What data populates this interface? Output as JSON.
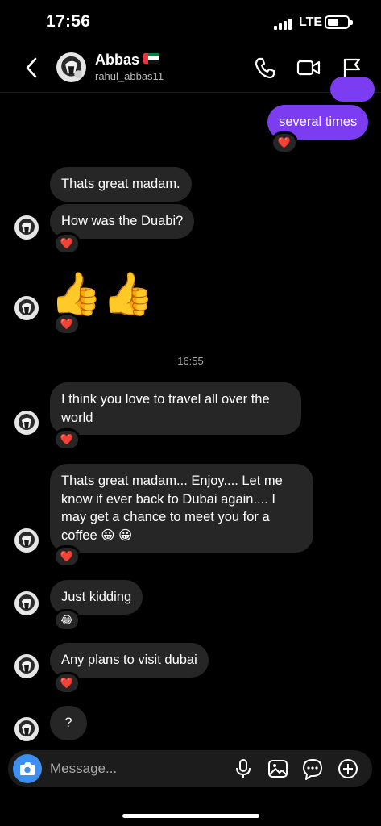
{
  "status_bar": {
    "time": "17:56",
    "network": "LTE"
  },
  "header": {
    "name": "Abbas",
    "username": "rahul_abbas11"
  },
  "messages": {
    "m0": {
      "text": "several times",
      "reaction": "❤️"
    },
    "m1": {
      "text": "Thats great madam."
    },
    "m2": {
      "text": "How was the Duabi?",
      "reaction": "❤️"
    },
    "m3": {
      "text": "👍👍",
      "reaction": "❤️"
    },
    "timestamp": "16:55",
    "m4": {
      "text": "I think you love to travel all over the world",
      "reaction": "❤️"
    },
    "m5": {
      "text": "Thats great madam... Enjoy.... Let me know if ever back to Dubai again.... I may get a chance to meet you for a coffee 😀 😀",
      "reaction": "❤️"
    },
    "m6": {
      "text": "Just kidding",
      "reaction": "😂"
    },
    "m7": {
      "text": "Any plans to visit dubai",
      "reaction": "❤️"
    },
    "m8": {
      "text": "?"
    }
  },
  "composer": {
    "placeholder": "Message..."
  },
  "colors": {
    "outgoing_bubble": "#7c3cf2",
    "incoming_bubble": "#262626",
    "camera_button": "#3d8ff0",
    "background": "#000000"
  },
  "icons": [
    "back-icon",
    "phone-icon",
    "video-camera-icon",
    "flag-icon",
    "camera-icon",
    "microphone-icon",
    "gallery-icon",
    "sticker-icon",
    "plus-icon"
  ]
}
